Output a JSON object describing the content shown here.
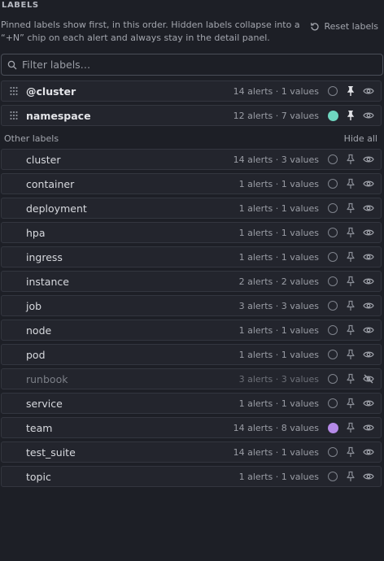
{
  "header": {
    "title": "LABELS",
    "description": "Pinned labels show first, in this order. Hidden labels collapse into a “+N” chip on each alert and always stay in the detail panel.",
    "reset_label": "Reset labels"
  },
  "filter": {
    "placeholder": "Filter labels…",
    "value": ""
  },
  "pinned": [
    {
      "name": "@cluster",
      "meta": "14 alerts · 1 values",
      "color": null,
      "pinned": true,
      "visible": true
    },
    {
      "name": "namespace",
      "meta": "12 alerts · 7 values",
      "color": "#6fd6c0",
      "pinned": true,
      "visible": true
    }
  ],
  "other_section": {
    "label": "Other labels",
    "hide_all": "Hide all"
  },
  "others": [
    {
      "name": "cluster",
      "meta": "14 alerts · 3 values",
      "color": null,
      "visible": true
    },
    {
      "name": "container",
      "meta": "1 alerts · 1 values",
      "color": null,
      "visible": true
    },
    {
      "name": "deployment",
      "meta": "1 alerts · 1 values",
      "color": null,
      "visible": true
    },
    {
      "name": "hpa",
      "meta": "1 alerts · 1 values",
      "color": null,
      "visible": true
    },
    {
      "name": "ingress",
      "meta": "1 alerts · 1 values",
      "color": null,
      "visible": true
    },
    {
      "name": "instance",
      "meta": "2 alerts · 2 values",
      "color": null,
      "visible": true
    },
    {
      "name": "job",
      "meta": "3 alerts · 3 values",
      "color": null,
      "visible": true
    },
    {
      "name": "node",
      "meta": "1 alerts · 1 values",
      "color": null,
      "visible": true
    },
    {
      "name": "pod",
      "meta": "1 alerts · 1 values",
      "color": null,
      "visible": true
    },
    {
      "name": "runbook",
      "meta": "3 alerts · 3 values",
      "color": null,
      "visible": false
    },
    {
      "name": "service",
      "meta": "1 alerts · 1 values",
      "color": null,
      "visible": true
    },
    {
      "name": "team",
      "meta": "14 alerts · 8 values",
      "color": "#b58ae8",
      "visible": true
    },
    {
      "name": "test_suite",
      "meta": "14 alerts · 1 values",
      "color": null,
      "visible": true
    },
    {
      "name": "topic",
      "meta": "1 alerts · 1 values",
      "color": null,
      "visible": true
    }
  ],
  "icons": {
    "drag": "drag-handle-icon",
    "color": "color-swatch-icon",
    "pin": "pin-icon",
    "eye": "eye-icon",
    "eye_off": "eye-off-icon",
    "reset": "reset-icon",
    "search": "search-icon"
  },
  "colors": {
    "background": "#1d1f26",
    "row": "#23252d",
    "border": "#33363f"
  }
}
